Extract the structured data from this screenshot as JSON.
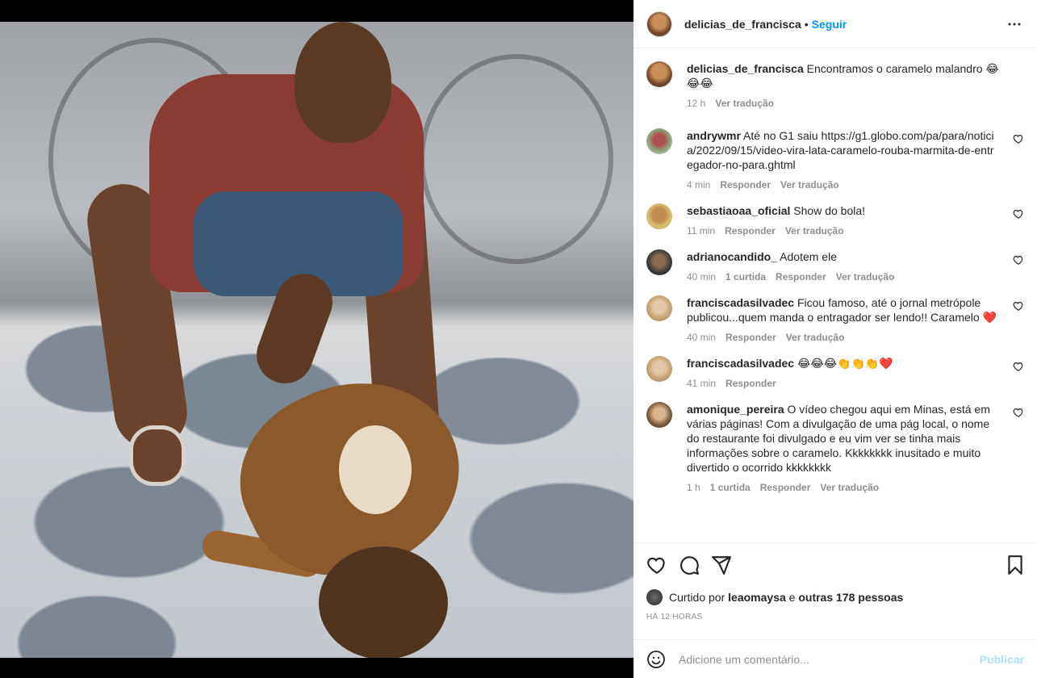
{
  "post": {
    "author": "delicias_de_francisca",
    "follow_label": "Seguir",
    "caption": "Encontramos o caramelo malandro 😂😂😂",
    "caption_time": "12 h",
    "caption_translate": "Ver tradução"
  },
  "comments": [
    {
      "user": "andrywmr",
      "text": "Até no G1 saiu https://g1.globo.com/pa/para/noticia/2022/09/15/video-vira-lata-caramelo-rouba-marmita-de-entregador-no-para.ghtml",
      "time": "4 min",
      "likes": "",
      "reply": "Responder",
      "translate": "Ver tradução"
    },
    {
      "user": "sebastiaoaa_oficial",
      "text": "Show do bola!",
      "time": "11 min",
      "likes": "",
      "reply": "Responder",
      "translate": "Ver tradução"
    },
    {
      "user": "adrianocandido_",
      "text": "Adotem ele",
      "time": "40 min",
      "likes": "1 curtida",
      "reply": "Responder",
      "translate": "Ver tradução"
    },
    {
      "user": "franciscadasilvadec",
      "text": "Ficou famoso, até o jornal metrópole publicou...quem manda o entragador ser lendo!! Caramelo ❤️",
      "time": "40 min",
      "likes": "",
      "reply": "Responder",
      "translate": "Ver tradução"
    },
    {
      "user": "franciscadasilvadec",
      "text": "😂😂😂👏👏👏❤️",
      "time": "41 min",
      "likes": "",
      "reply": "Responder",
      "translate": ""
    },
    {
      "user": "amonique_pereira",
      "text": "O vídeo chegou aqui em Minas, está em várias páginas! Com a divulgação de uma pág local, o nome do restaurante foi divulgado e eu vim ver se tinha mais informações sobre o caramelo. Kkkkkkkk inusitado e muito divertido o ocorrido kkkkkkkk",
      "time": "1 h",
      "likes": "1 curtida",
      "reply": "Responder",
      "translate": "Ver tradução"
    }
  ],
  "likes_bar": {
    "prefix": "Curtido por",
    "user": "leaomaysa",
    "conj": "e",
    "others": "outras 178 pessoas"
  },
  "time_ago": "HÁ 12 HORAS",
  "comment_box": {
    "placeholder": "Adicione um comentário...",
    "publish_label": "Publicar"
  },
  "colors": {
    "accent": "#0095f6",
    "publish_disabled": "#b2dffc",
    "muted": "#8e8e8e",
    "text": "#262626"
  },
  "icons": [
    "more-icon",
    "heart-icon",
    "comment-icon",
    "share-icon",
    "bookmark-icon",
    "emoji-icon",
    "small-heart-icon"
  ]
}
